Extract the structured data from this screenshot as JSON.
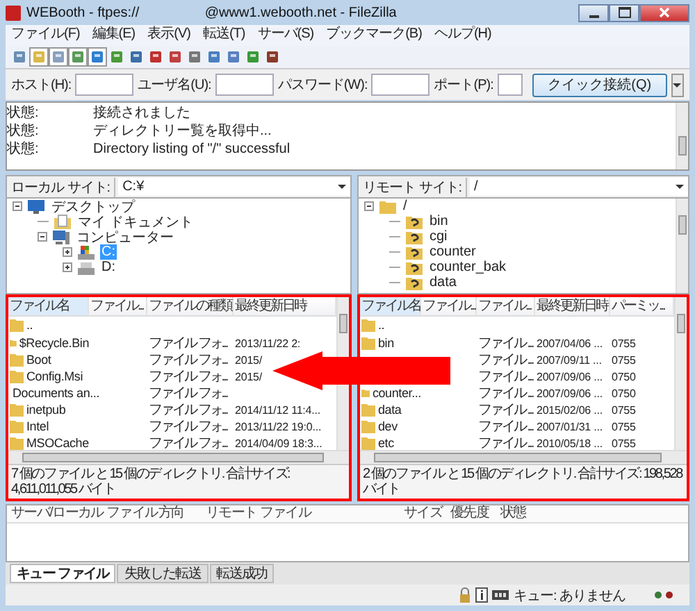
{
  "window": {
    "title": "WEBooth - ftpes://                 @www1.webooth.net - FileZilla"
  },
  "menu": [
    "ファイル(F)",
    "編集(E)",
    "表示(V)",
    "転送(T)",
    "サーバ(S)",
    "ブックマーク(B)",
    "ヘルプ(H)"
  ],
  "quick_connect": {
    "fields": [
      {
        "label": "ホスト(H):"
      },
      {
        "label": "ユーザ名(U):"
      },
      {
        "label": "パスワード(W):"
      },
      {
        "label": "ポート(P):"
      }
    ],
    "button": "クイック接続(Q)"
  },
  "log": [
    {
      "label": "状態:",
      "message": "接続されました"
    },
    {
      "label": "状態:",
      "message": "ディレクトリー覧を取得中..."
    },
    {
      "label": "状態:",
      "message": "Directory listing of \"/\" successful"
    }
  ],
  "local": {
    "site_label": "ローカル サイト:",
    "path": "C:¥",
    "highlighted": true,
    "tree": [
      {
        "label": "デスクトップ",
        "kind": "desktop",
        "expanded": true,
        "selected": false,
        "children": [
          {
            "label": "マイ ドキュメント",
            "kind": "documents",
            "selected": false
          },
          {
            "label": "コンピューター",
            "kind": "computer",
            "expanded": true,
            "selected": false,
            "children": [
              {
                "label": "C:",
                "kind": "drive-system",
                "expanded": false,
                "selected": true
              },
              {
                "label": "D:",
                "kind": "drive",
                "expanded": false,
                "selected": false
              }
            ]
          }
        ]
      }
    ],
    "list": {
      "columns": [
        "ファイル名",
        "ファイル...",
        "ファイルの種類",
        "最終更新日時"
      ],
      "rows": [
        {
          "kind": "folder",
          "name": ".."
        },
        {
          "kind": "folder",
          "name": "$Recycle.Bin",
          "type": "ファイル フォ...",
          "modified": "2013/11/22 2:"
        },
        {
          "kind": "folder",
          "name": "Boot",
          "type": "ファイル フォ...",
          "modified": "2015/"
        },
        {
          "kind": "folder",
          "name": "Config.Msi",
          "type": "ファイル フォ...",
          "modified": "2015/"
        },
        {
          "kind": "folder",
          "name": "Documents an...",
          "type": "ファイル フォ..."
        },
        {
          "kind": "folder",
          "name": "inetpub",
          "type": "ファイル フォ...",
          "modified": "2014/11/12 11:4..."
        },
        {
          "kind": "folder",
          "name": "Intel",
          "type": "ファイル フォ...",
          "modified": "2013/11/22 19:0..."
        },
        {
          "kind": "folder",
          "name": "MSOCache",
          "type": "ファイル フォ...",
          "modified": "2014/04/09 18:3..."
        }
      ],
      "summary": "7 個のファイル と 15 個のディレクトリ. 合計サイズ: 4,611,011,055 バイト"
    }
  },
  "remote": {
    "site_label": "リモート サイト:",
    "path": "/",
    "highlighted": true,
    "tree": [
      {
        "label": "/",
        "kind": "folder",
        "expanded": true,
        "selected": false,
        "children": [
          {
            "label": "bin",
            "kind": "folder-unknown",
            "selected": false
          },
          {
            "label": "cgi",
            "kind": "folder-unknown",
            "selected": false
          },
          {
            "label": "counter",
            "kind": "folder-unknown",
            "selected": false
          },
          {
            "label": "counter_bak",
            "kind": "folder-unknown",
            "selected": false
          },
          {
            "label": "data",
            "kind": "folder-unknown",
            "selected": false
          }
        ]
      }
    ],
    "list": {
      "columns": [
        "ファイル名",
        "ファイル...",
        "ファイル...",
        "最終更新日時",
        "パーミッ..."
      ],
      "rows": [
        {
          "kind": "folder",
          "name": ".."
        },
        {
          "kind": "folder",
          "name": "bin",
          "type": "ファイル ...",
          "modified": "2007/04/06 ...",
          "permissions": "0755"
        },
        {
          "type": "ファイル ...",
          "modified": "2007/09/11 ...",
          "permissions": "0755"
        },
        {
          "type": "ファイル ...",
          "modified": "2007/09/06 ...",
          "permissions": "0750"
        },
        {
          "kind": "folder",
          "name": "counter...",
          "type": "ファイル ...",
          "modified": "2007/09/06 ...",
          "permissions": "0750"
        },
        {
          "kind": "folder",
          "name": "data",
          "type": "ファイル ...",
          "modified": "2015/02/06 ...",
          "permissions": "0755"
        },
        {
          "kind": "folder",
          "name": "dev",
          "type": "ファイル ...",
          "modified": "2007/01/31 ...",
          "permissions": "0755"
        },
        {
          "kind": "folder",
          "name": "etc",
          "type": "ファイル ...",
          "modified": "2010/05/18 ...",
          "permissions": "0755"
        }
      ],
      "summary": "2 個のファイル と 15 個のディレクトリ. 合計サイズ: 198,528 バイト"
    }
  },
  "queue": {
    "columns": [
      "サーバ/ローカル ファイル",
      "方向",
      "リモート ファイル",
      "サイズ",
      "優先度",
      "状態"
    ]
  },
  "queue_tabs": [
    {
      "label": "キュー ファイル",
      "selected": true
    },
    {
      "label": "失敗した転送",
      "selected": false
    },
    {
      "label": "転送成功",
      "selected": false
    }
  ],
  "status_bar": {
    "queue": "キュー: ありません"
  },
  "overlay": {
    "kind": "arrow-left"
  }
}
